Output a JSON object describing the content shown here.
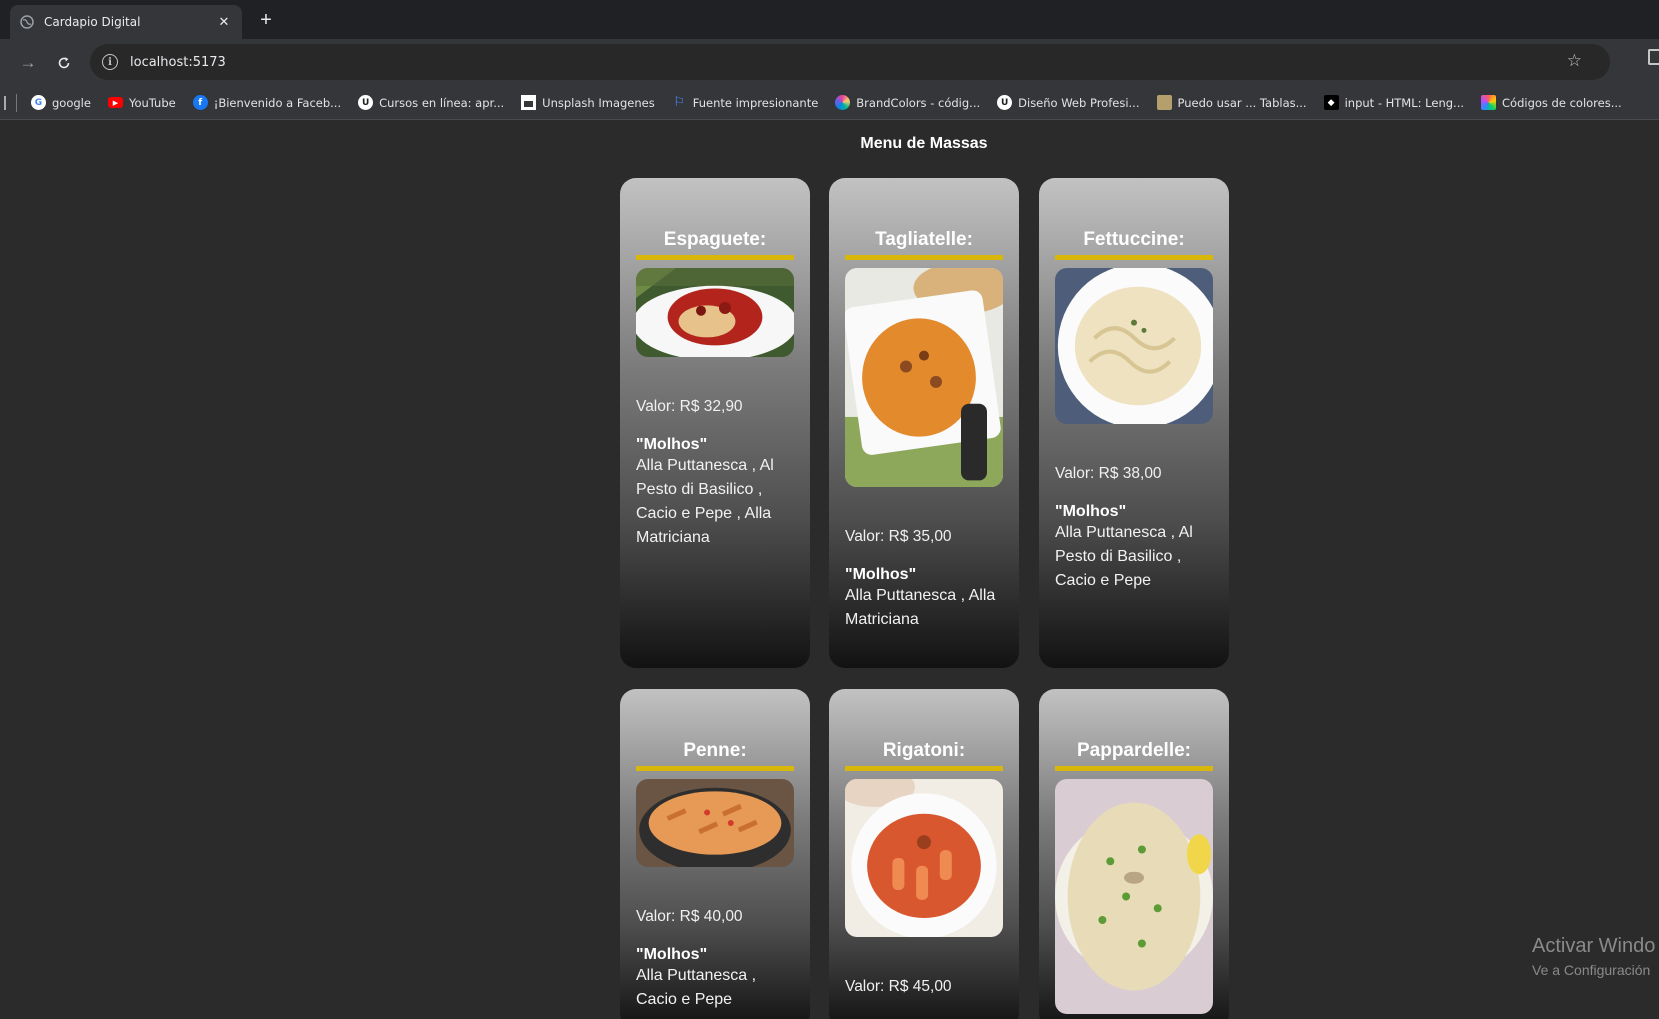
{
  "browser": {
    "tab_title": "Cardapio Digital",
    "url": "localhost:5173",
    "bookmarks": [
      {
        "label": "google",
        "icon": "google-icon",
        "color": "#ffffff"
      },
      {
        "label": "YouTube",
        "icon": "youtube-icon",
        "color": "#ff0000"
      },
      {
        "label": "¡Bienvenido a Faceb...",
        "icon": "facebook-icon",
        "color": "#1877f2"
      },
      {
        "label": "Cursos en línea: apr...",
        "icon": "udemy-icon",
        "color": "#ffffff"
      },
      {
        "label": "Unsplash Imagenes",
        "icon": "unsplash-icon",
        "color": "#ffffff"
      },
      {
        "label": "Fuente impresionante",
        "icon": "flag-icon",
        "color": "#4a8cff"
      },
      {
        "label": "BrandColors - códig...",
        "icon": "brandcolors-icon",
        "color": "#e84393"
      },
      {
        "label": "Diseño Web Profesi...",
        "icon": "udemy-icon",
        "color": "#ffffff"
      },
      {
        "label": "Puedo usar ... Tablas...",
        "icon": "caniuse-icon",
        "color": "#b5a06d"
      },
      {
        "label": "input - HTML: Leng...",
        "icon": "mdn-icon",
        "color": "#ffffff"
      },
      {
        "label": "Códigos de colores...",
        "icon": "colorcodes-icon",
        "color": "#ff5a5a"
      }
    ]
  },
  "page": {
    "title": "Menu de Massas",
    "accent_color": "#d9b70a",
    "cards": [
      {
        "name": "Espaguete:",
        "price": "Valor: R$ 32,90",
        "sauce_title": "\"Molhos\"",
        "sauces": "Alla Puttanesca , Al Pesto di Basilico , Cacio e Pepe , Alla Matriciana",
        "image": "spaghetti-photo"
      },
      {
        "name": "Tagliatelle:",
        "price": "Valor: R$ 35,00",
        "sauce_title": "\"Molhos\"",
        "sauces": "Alla Puttanesca , Alla Matriciana",
        "image": "tagliatelle-photo"
      },
      {
        "name": "Fettuccine:",
        "price": "Valor: R$ 38,00",
        "sauce_title": "\"Molhos\"",
        "sauces": "Alla Puttanesca , Al Pesto di Basilico , Cacio e Pepe",
        "image": "fettuccine-photo"
      },
      {
        "name": "Penne:",
        "price": "Valor: R$ 40,00",
        "sauce_title": "\"Molhos\"",
        "sauces": "Alla Puttanesca , Cacio e Pepe",
        "image": "penne-photo"
      },
      {
        "name": "Rigatoni:",
        "price": "Valor: R$ 45,00",
        "sauce_title": "",
        "sauces": "",
        "image": "rigatoni-photo"
      },
      {
        "name": "Pappardelle:",
        "price": "",
        "sauce_title": "",
        "sauces": "",
        "image": "pappardelle-photo"
      }
    ]
  },
  "watermark": {
    "line1": "Activar Windo",
    "line2": "Ve a Configuración"
  }
}
